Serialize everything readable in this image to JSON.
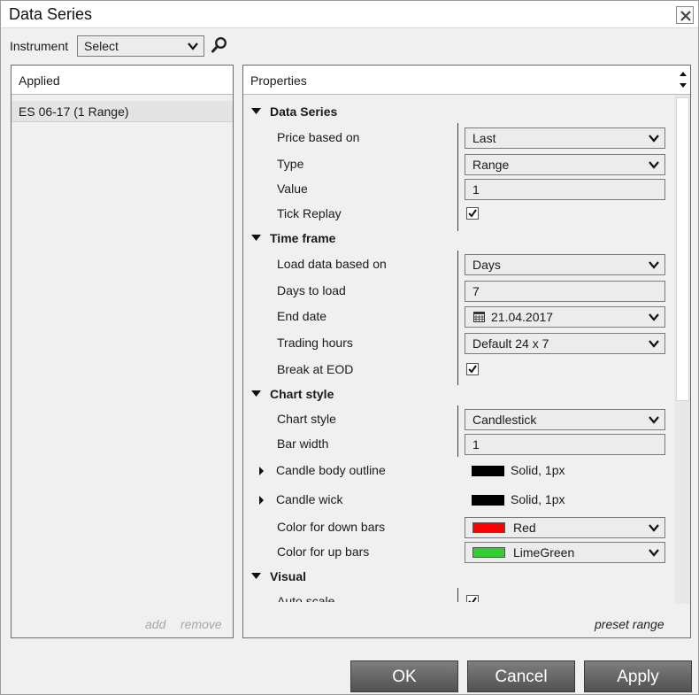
{
  "window": {
    "title": "Data Series"
  },
  "instrument": {
    "label": "Instrument",
    "value": "Select"
  },
  "applied": {
    "header": "Applied",
    "items": [
      "ES 06-17 (1 Range)"
    ],
    "add_label": "add",
    "remove_label": "remove"
  },
  "properties": {
    "header": "Properties",
    "preset_label": "preset range",
    "data_series": {
      "title": "Data Series",
      "price_based_on_label": "Price based on",
      "price_based_on_value": "Last",
      "type_label": "Type",
      "type_value": "Range",
      "value_label": "Value",
      "value_value": "1",
      "tick_replay_label": "Tick Replay",
      "tick_replay_checked": true
    },
    "time_frame": {
      "title": "Time frame",
      "load_label": "Load data based on",
      "load_value": "Days",
      "days_label": "Days to load",
      "days_value": "7",
      "end_date_label": "End date",
      "end_date_value": "21.04.2017",
      "trading_hours_label": "Trading hours",
      "trading_hours_value": "Default 24 x 7",
      "break_eod_label": "Break at EOD",
      "break_eod_checked": true
    },
    "chart_style": {
      "title": "Chart style",
      "style_label": "Chart style",
      "style_value": "Candlestick",
      "bar_width_label": "Bar width",
      "bar_width_value": "1",
      "body_outline_label": "Candle body outline",
      "body_outline_value": "Solid, 1px",
      "wick_label": "Candle wick",
      "wick_value": "Solid, 1px",
      "down_label": "Color for down bars",
      "down_value": "Red",
      "down_color": "#ff0000",
      "up_label": "Color for up bars",
      "up_value": "LimeGreen",
      "up_color": "#32cd32"
    },
    "visual": {
      "title": "Visual",
      "auto_scale_label": "Auto scale",
      "auto_scale_checked": true
    }
  },
  "buttons": {
    "ok": "OK",
    "cancel": "Cancel",
    "apply": "Apply"
  }
}
